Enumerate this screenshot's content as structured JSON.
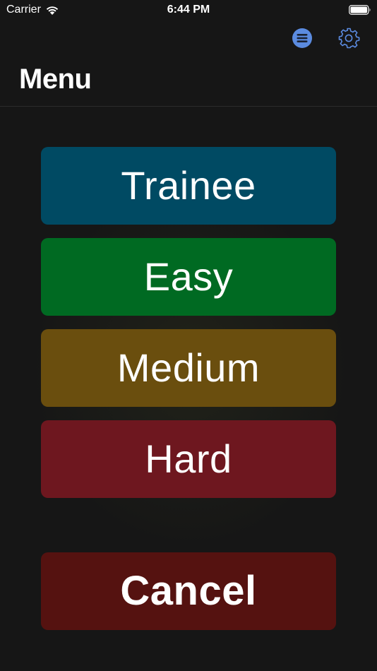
{
  "status_bar": {
    "carrier": "Carrier",
    "time": "6:44 PM"
  },
  "nav": {
    "title": "Menu",
    "icons": [
      "list-icon",
      "gear-icon"
    ]
  },
  "menu": {
    "trainee": "Trainee",
    "easy": "Easy",
    "medium": "Medium",
    "hard": "Hard",
    "cancel": "Cancel"
  },
  "colors": {
    "background": "#161616",
    "accent": "#5b8be0",
    "trainee": "#004a63",
    "easy": "#006a22",
    "medium": "#6a4e0e",
    "hard": "#6e171f",
    "cancel": "#551210"
  }
}
